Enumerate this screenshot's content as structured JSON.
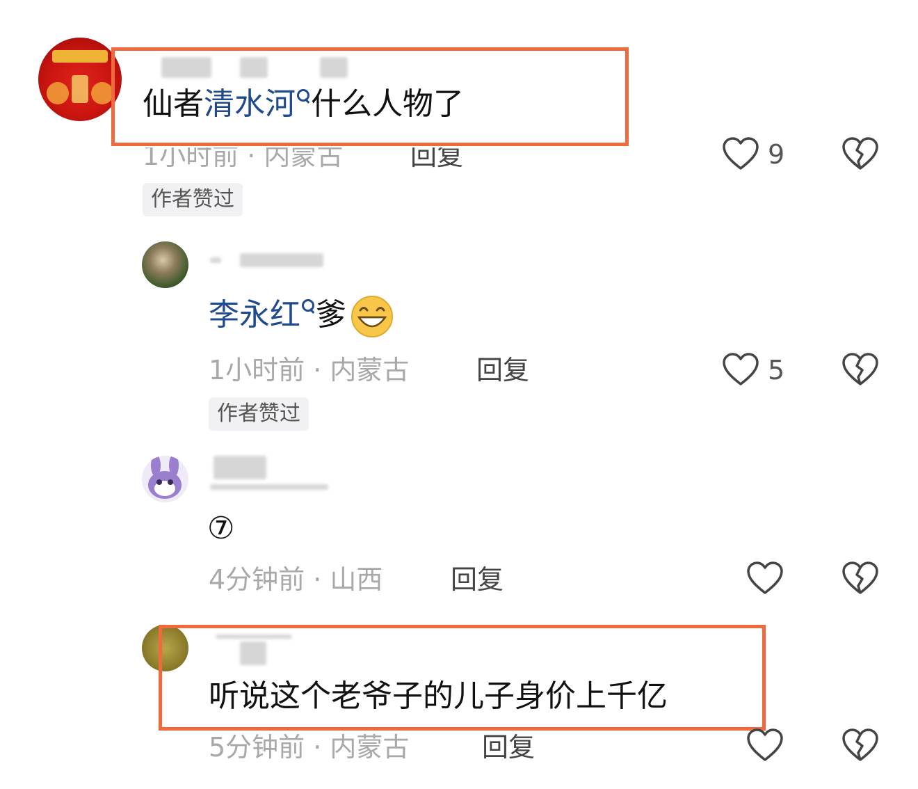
{
  "comments": [
    {
      "text_prefix": "仙者",
      "topic": "清水河",
      "text_suffix": "什么人物了",
      "meta": "1小时前 · 内蒙古",
      "reply_label": "回复",
      "like_count": "9",
      "author_liked": "作者赞过",
      "highlighted": true
    },
    {
      "topic": "李永红",
      "text_suffix": "爹",
      "emoji": "grinning-face-icon",
      "meta": "1小时前 · 内蒙古",
      "reply_label": "回复",
      "like_count": "5",
      "author_liked": "作者赞过"
    },
    {
      "text": "⑦",
      "meta": "4分钟前 · 山西",
      "reply_label": "回复"
    },
    {
      "text": "听说这个老爷子的儿子身价上千亿",
      "meta": "5分钟前 · 内蒙古",
      "reply_label": "回复",
      "highlighted": true
    }
  ],
  "colors": {
    "highlight_border": "#ef6a3c",
    "topic_link": "#1f4a8e",
    "meta_text": "#a8a8a8"
  }
}
